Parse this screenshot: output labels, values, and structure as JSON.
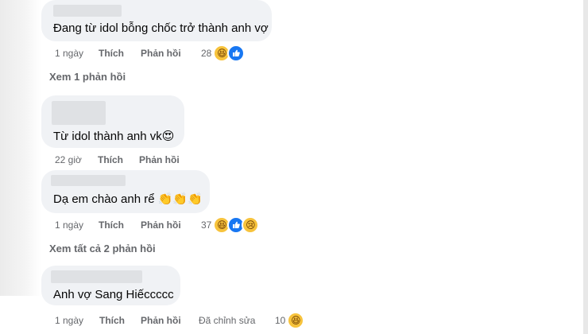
{
  "comments": [
    {
      "text": "Đang từ idol bỗng chốc trở thành anh vợ",
      "time": "1 ngày",
      "like_label": "Thích",
      "reply_label": "Phản hồi",
      "reaction_count": "28",
      "reactions": [
        "haha-icon",
        "like-icon"
      ],
      "view_replies": "Xem 1 phản hồi"
    },
    {
      "text": "Từ idol thành anh vk",
      "emojis": "😍",
      "time": "22 giờ",
      "like_label": "Thích",
      "reply_label": "Phản hồi"
    },
    {
      "text": "Dạ em chào anh rể",
      "emojis": "👏👏👏",
      "time": "1 ngày",
      "like_label": "Thích",
      "reply_label": "Phản hồi",
      "reaction_count": "37",
      "reactions": [
        "haha-icon",
        "like-icon",
        "sad-icon"
      ],
      "view_replies": "Xem tất cả 2 phản hồi"
    },
    {
      "text": "Anh vợ Sang Hiếccccc",
      "time": "1 ngày",
      "like_label": "Thích",
      "reply_label": "Phản hồi",
      "edited_label": "Đã chỉnh sửa",
      "reaction_count": "10",
      "reactions": [
        "haha-icon"
      ]
    }
  ],
  "colors": {
    "bubble": "#f0f2f5",
    "meta_text": "#65676b",
    "like_blue": "#1877f2",
    "haha_yellow": "#f7c33c"
  }
}
